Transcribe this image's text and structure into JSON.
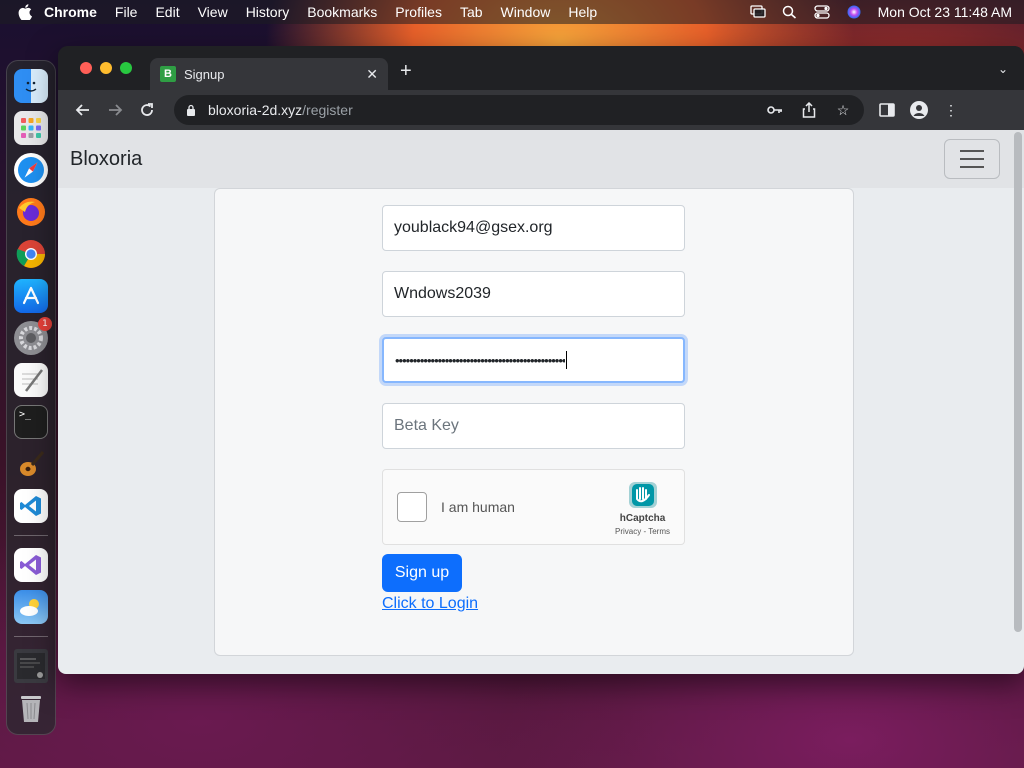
{
  "menubar": {
    "app": "Chrome",
    "items": [
      "File",
      "Edit",
      "View",
      "History",
      "Bookmarks",
      "Profiles",
      "Tab",
      "Window",
      "Help"
    ],
    "clock": "Mon Oct 23  11:48 AM"
  },
  "dock": {
    "items": [
      "finder-icon",
      "launchpad-icon",
      "safari-icon",
      "firefox-icon",
      "chrome-icon",
      "app-store-icon",
      "system-settings-icon",
      "textedit-icon",
      "terminal-icon",
      "garageband-icon",
      "vscode-icon",
      "visual-studio-icon",
      "weather-icon",
      "recent-window-icon",
      "trash-icon"
    ],
    "settings_badge": "1"
  },
  "browser": {
    "tab_title": "Signup",
    "tab_favicon": "B",
    "url_host": "bloxoria-2d.xyz",
    "url_path": "/register"
  },
  "page": {
    "brand": "Bloxoria",
    "email_value": "youblack94@gsex.org",
    "username_value": "Wndows2039",
    "password_masked": "••••••••••••••••••••••••••••••••••••••••••••••••",
    "beta_key_placeholder": "Beta Key",
    "captcha": {
      "label": "I am human",
      "brand": "hCaptcha",
      "links": "Privacy - Terms"
    },
    "signup_label": "Sign up",
    "login_link": "Click to Login"
  },
  "colors": {
    "primary": "#0d6efd",
    "focus_ring": "#86b7fe",
    "captcha_accent": "#00838f"
  }
}
